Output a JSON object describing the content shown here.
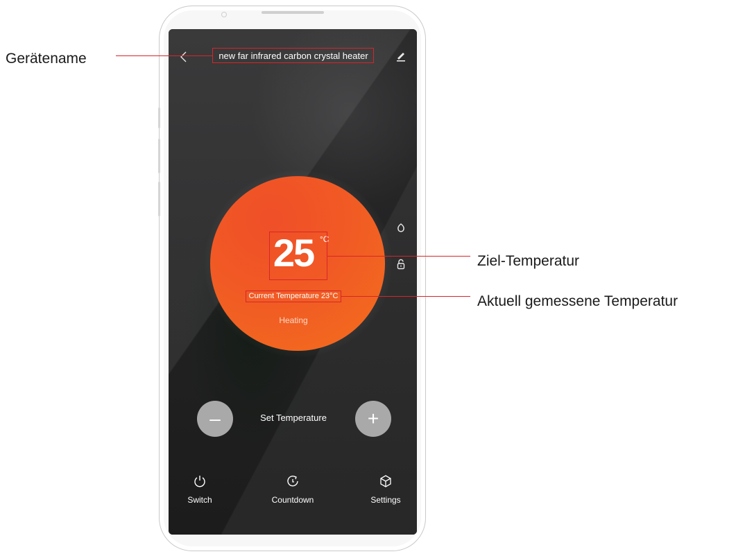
{
  "screen": {
    "device_name": "new far infrared carbon crystal heater",
    "target_temperature": "25",
    "temperature_unit": "°C",
    "current_temperature": "Current Temperature 23°C",
    "status": "Heating",
    "set_temperature_label": "Set Temperature",
    "decrease_label": "–",
    "increase_label": "+",
    "tabs": [
      {
        "label": "Switch",
        "icon": "power-icon"
      },
      {
        "label": "Countdown",
        "icon": "timer-icon"
      },
      {
        "label": "Settings",
        "icon": "cube-icon"
      }
    ],
    "side_icons": [
      "eco-leaf-icon",
      "lock-icon"
    ]
  },
  "annotations": {
    "device_name": "Gerätename",
    "target_temperature": "Ziel-Temperatur",
    "current_temperature": "Aktuell gemessene Temperatur"
  },
  "colors": {
    "dial": "#f15a24",
    "annotation": "#d6252a",
    "button": "#a9a9a9"
  }
}
